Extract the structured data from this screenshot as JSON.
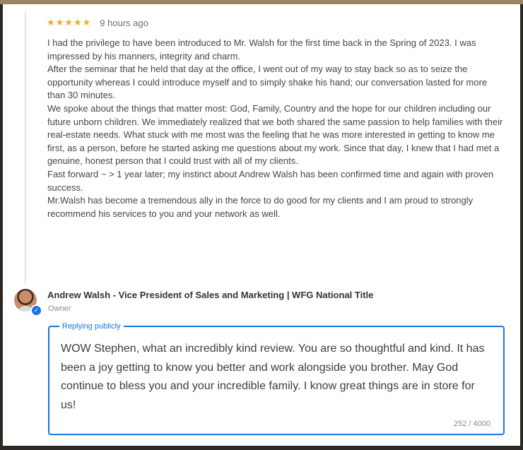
{
  "review": {
    "rating": "★★★★★",
    "time": "9 hours ago",
    "paragraphs": [
      "I had the privilege to have been introduced to Mr. Walsh for the first time back in the Spring of 2023. I was impressed by his manners, integrity and charm.",
      "After the seminar that he held that day at the office, I went out of my way to stay back so as to seize the opportunity whereas I could introduce myself and to simply shake his hand; our conversation lasted for more than 30 minutes.",
      "We spoke about the things that matter most: God, Family, Country and the hope for our children including our future unborn children. We immediately realized that we both shared the same passion to help families with their real-estate needs. What stuck with me most was the feeling that he was more interested in getting to know me first, as a person, before he started asking me questions about my work. Since that day, I knew that I had met a genuine, honest person that I could trust with all of my clients.",
      "Fast forward ~ > 1 year later; my instinct about Andrew Walsh has been confirmed time and again with proven success.",
      "Mr.Walsh has become a tremendous ally in the force to do good for my clients and I am proud to strongly recommend his services to you and your network as well."
    ]
  },
  "owner": {
    "name": "Andrew Walsh - Vice President of Sales and Marketing | WFG National Title",
    "role": "Owner",
    "badge_icon": "check-icon"
  },
  "reply": {
    "legend": "Replying publicly",
    "text": "WOW Stephen, what an incredibly kind review. You are so thoughtful and kind. It has been a joy getting to know you better and work alongside you brother. May God continue to bless you and your incredible family. I know great things are in store for us!",
    "char_count": "252 / 4000"
  },
  "colors": {
    "accent": "#1a73e8",
    "stars": "#f5a623"
  }
}
